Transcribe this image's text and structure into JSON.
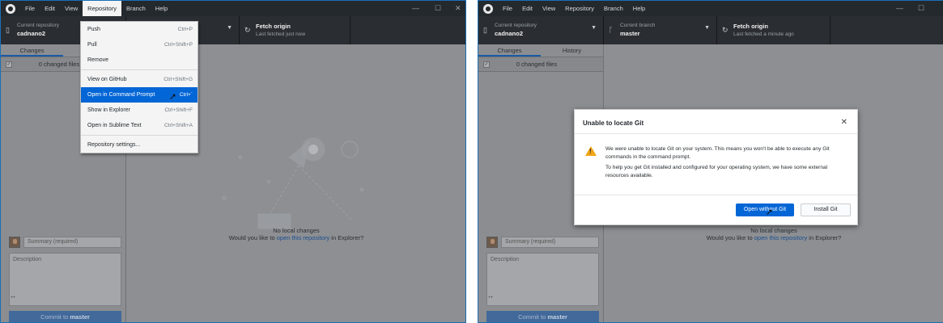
{
  "app_menus": [
    "File",
    "Edit",
    "View",
    "Repository",
    "Branch",
    "Help"
  ],
  "window_controls": {
    "minimize": "—",
    "maximize": "☐",
    "close": "✕"
  },
  "left": {
    "repo": {
      "small": "Current repository",
      "name": "cadnano2"
    },
    "fetch": {
      "title": "Fetch origin",
      "subtitle": "Last fetched just now"
    },
    "tabs": {
      "changes": "Changes"
    },
    "changed_files": "0 changed files",
    "dropdown": [
      {
        "label": "Push",
        "shortcut": "Ctrl+P"
      },
      {
        "label": "Pull",
        "shortcut": "Ctrl+Shift+P"
      },
      {
        "label": "Remove",
        "shortcut": ""
      },
      {
        "label": "View on GitHub",
        "shortcut": "Ctrl+Shift+G"
      },
      {
        "label": "Open in Command Prompt",
        "shortcut": "Ctrl+`"
      },
      {
        "label": "Show in Explorer",
        "shortcut": "Ctrl+Shift+F"
      },
      {
        "label": "Open in Sublime Text",
        "shortcut": "Ctrl+Shift+A"
      },
      {
        "label": "Repository settings...",
        "shortcut": ""
      }
    ]
  },
  "right": {
    "repo": {
      "small": "Current repository",
      "name": "cadnano2"
    },
    "branch": {
      "small": "Current branch",
      "name": "master"
    },
    "fetch": {
      "title": "Fetch origin",
      "subtitle": "Last fetched a minute ago"
    },
    "tabs": {
      "changes": "Changes",
      "history": "History"
    },
    "changed_files": "0 changed files",
    "dialog": {
      "title": "Unable to locate Git",
      "close": "✕",
      "p1": "We were unable to locate Git on your system. This means you won't be able to execute any Git commands in the command prompt.",
      "p2": "To help you get Git installed and configured for your operating system, we have some external resources available.",
      "primary": "Open without Git",
      "secondary": "Install Git"
    }
  },
  "sidebar": {
    "summary_placeholder": "Summary (required)",
    "description_placeholder": "Description",
    "coauthor": "+•",
    "commit_prefix": "Commit to ",
    "commit_branch": "master"
  },
  "empty_state": {
    "line1": "No local changes",
    "line2_pre": "Would you like to ",
    "line2_link": "open this repository",
    "line2_post": " in Explorer?"
  }
}
